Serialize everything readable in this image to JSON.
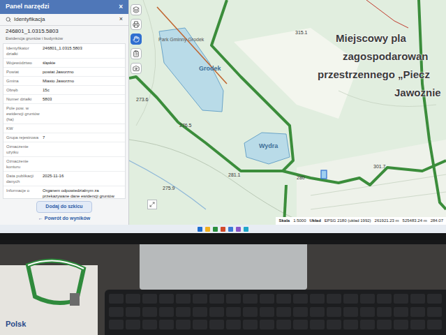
{
  "panel": {
    "title": "Panel narzędzi",
    "close": "×",
    "section": "Identyfikacja",
    "section_close": "×",
    "result_id": "246801_1.0315.5803",
    "subtitle": "Ewidencja gruntów i budynków",
    "fields": [
      {
        "label": "Identyfikator działki",
        "value": "246801_1.0315.5803"
      },
      {
        "label": "Województwo",
        "value": "śląskie"
      },
      {
        "label": "Powiat",
        "value": "powiat Jaworzno"
      },
      {
        "label": "Gmina",
        "value": "Miasto Jaworzno"
      },
      {
        "label": "Obręb",
        "value": "15c"
      },
      {
        "label": "Numer działki",
        "value": "5803"
      },
      {
        "label": "Pole pow. w ewidencji gruntów (ha)",
        "value": ""
      },
      {
        "label": "KW",
        "value": ""
      },
      {
        "label": "Grupa rejestrowa",
        "value": "7"
      },
      {
        "label": "Oznaczenie użytku",
        "value": ""
      },
      {
        "label": "Oznaczenie konturu",
        "value": ""
      },
      {
        "label": "Data publikacji danych",
        "value": "2025-11-16"
      },
      {
        "label": "Informacje o",
        "value": "Organem odpowiedzialnym za przekazywane dane ewidencji gruntów"
      }
    ],
    "add_button": "Dodaj do szkicu",
    "back_link": "← Powrót do wyników"
  },
  "toolbar": [
    {
      "tool": "layers",
      "selected": false
    },
    {
      "tool": "print",
      "selected": false
    },
    {
      "tool": "identify",
      "selected": true
    },
    {
      "tool": "list",
      "selected": false
    },
    {
      "tool": "screenshot",
      "selected": false
    }
  ],
  "map": {
    "labels": [
      {
        "text": "Park Gminny Grodek",
        "kind": "name"
      },
      {
        "text": "Grodek",
        "kind": "water"
      },
      {
        "text": "Wydra",
        "kind": "water"
      },
      {
        "text": "315.1",
        "kind": "height"
      },
      {
        "text": "273.6",
        "kind": "height"
      },
      {
        "text": "276.5",
        "kind": "height"
      },
      {
        "text": "275.9",
        "kind": "height"
      },
      {
        "text": "281.1",
        "kind": "height"
      },
      {
        "text": "280",
        "kind": "height"
      },
      {
        "text": "301.7",
        "kind": "height"
      }
    ],
    "plan_title": [
      "Miejscowy pla",
      "zagospodarowan",
      "przestrzennego „Piecz",
      "Jawoznie"
    ]
  },
  "status_bar": {
    "scale_label": "Skala",
    "scale": "1:5000",
    "crs_label": "Układ",
    "crs": "EPSG 2180 (układ 1992)",
    "x": "261921.23 m",
    "y": "525483.24 m",
    "z": "284.07"
  },
  "desk": {
    "paper_text": "Polsk"
  }
}
